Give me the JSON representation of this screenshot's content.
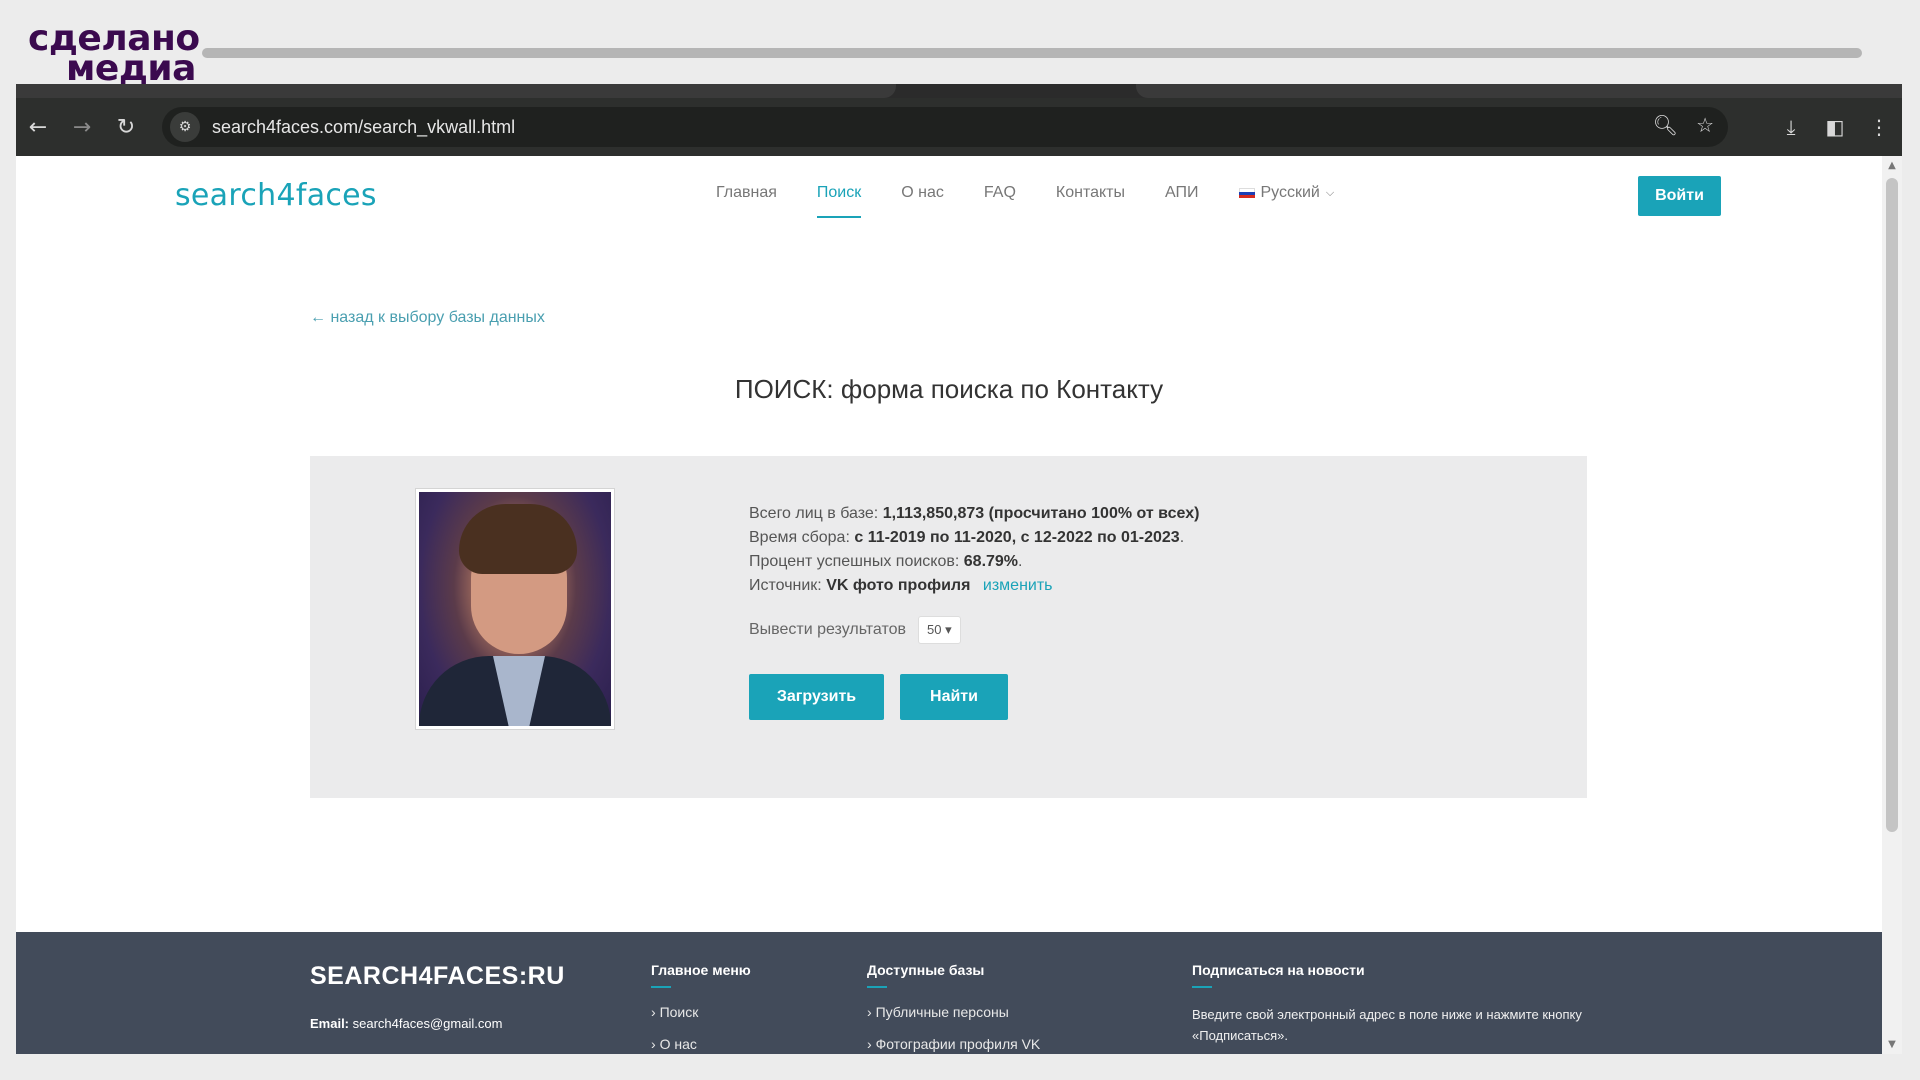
{
  "watermark": {
    "line1": "сделано",
    "line2": "медиа"
  },
  "browser": {
    "url": "search4faces.com/search_vkwall.html"
  },
  "site": {
    "logo": "search4faces",
    "nav": [
      {
        "label": "Главная"
      },
      {
        "label": "Поиск",
        "active": true
      },
      {
        "label": "О нас"
      },
      {
        "label": "FAQ"
      },
      {
        "label": "Контакты"
      },
      {
        "label": "АПИ"
      }
    ],
    "language": "Русский",
    "login_label": "Войти"
  },
  "main": {
    "back_link": "← назад к выбору базы данных",
    "title": "ПОИСК: форма поиска по Контакту",
    "stats": {
      "total_label": "Всего лиц в базе:",
      "total_value": "1,113,850,873 (просчитано 100% от всех)",
      "period_label": "Время сбора:",
      "period_value": "с 11-2019 по 11-2020, с 12-2022 по 01-2023",
      "period_end": ".",
      "success_label": "Процент успешных поисков:",
      "success_value": "68.79%",
      "success_end": ".",
      "source_label": "Источник:",
      "source_value": "VK фото профиля",
      "change_link": "изменить"
    },
    "results_label": "Вывести результатов",
    "results_value": "50",
    "upload_label": "Загрузить",
    "find_label": "Найти"
  },
  "footer": {
    "brand": "SEARCH4FACES:RU",
    "email_label": "Email:",
    "email_value": "search4faces@gmail.com",
    "menu_title": "Главное меню",
    "menu_items": [
      "Поиск",
      "О нас"
    ],
    "bases_title": "Доступные базы",
    "bases_items": [
      "Публичные персоны",
      "Фотографии профиля VK"
    ],
    "subscribe_title": "Подписаться на новости",
    "subscribe_text": "Введите свой электронный адрес в поле ниже и нажмите кнопку «Подписаться»."
  },
  "colors": {
    "accent": "#1aa3b8",
    "footer_bg": "#424b5a",
    "card_bg": "#ebebec"
  },
  "icons": [
    "back-arrow-icon",
    "forward-arrow-icon",
    "reload-icon",
    "site-settings-icon",
    "zoom-icon",
    "star-icon",
    "download-icon",
    "side-panel-icon",
    "menu-icon",
    "russia-flag-icon",
    "chevron-down-icon"
  ]
}
